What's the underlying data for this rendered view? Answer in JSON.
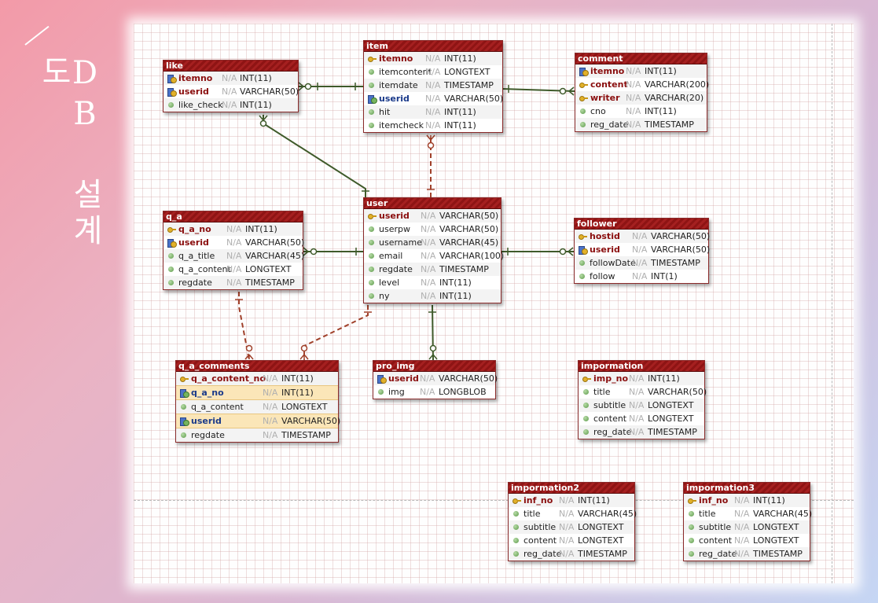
{
  "title": "DB 설계도",
  "colors": {
    "header": "#9a1a1a",
    "solid_link": "#3f5a2a",
    "dashed_link": "#a0402a"
  },
  "tables": [
    {
      "id": "like",
      "name": "like",
      "columns": [
        {
          "name": "itemno",
          "icon": "fk",
          "null": "N/A",
          "type": "INT(11)",
          "key": true
        },
        {
          "name": "userid",
          "icon": "fk",
          "null": "N/A",
          "type": "VARCHAR(50)",
          "key": true
        },
        {
          "name": "like_check",
          "icon": "dot",
          "null": "N/A",
          "type": "INT(11)"
        }
      ]
    },
    {
      "id": "item",
      "name": "item",
      "columns": [
        {
          "name": "itemno",
          "icon": "pk",
          "null": "N/A",
          "type": "INT(11)",
          "key": true
        },
        {
          "name": "itemcontent",
          "icon": "dot",
          "null": "N/A",
          "type": "LONGTEXT"
        },
        {
          "name": "itemdate",
          "icon": "dot",
          "null": "N/A",
          "type": "TIMESTAMP"
        },
        {
          "name": "userid",
          "icon": "fkn",
          "null": "N/A",
          "type": "VARCHAR(50)",
          "fk": true
        },
        {
          "name": "hit",
          "icon": "dot",
          "null": "N/A",
          "type": "INT(11)"
        },
        {
          "name": "itemcheck",
          "icon": "dot",
          "null": "N/A",
          "type": "INT(11)"
        }
      ]
    },
    {
      "id": "comment",
      "name": "comment",
      "columns": [
        {
          "name": "itemno",
          "icon": "fk",
          "null": "N/A",
          "type": "INT(11)",
          "key": true
        },
        {
          "name": "content",
          "icon": "pk",
          "null": "N/A",
          "type": "VARCHAR(200)",
          "key": true
        },
        {
          "name": "writer",
          "icon": "pk",
          "null": "N/A",
          "type": "VARCHAR(20)",
          "key": true
        },
        {
          "name": "cno",
          "icon": "dot",
          "null": "N/A",
          "type": "INT(11)"
        },
        {
          "name": "reg_date",
          "icon": "dot",
          "null": "N/A",
          "type": "TIMESTAMP"
        }
      ]
    },
    {
      "id": "q_a",
      "name": "q_a",
      "columns": [
        {
          "name": "q_a_no",
          "icon": "pk",
          "null": "N/A",
          "type": "INT(11)",
          "key": true
        },
        {
          "name": "userid",
          "icon": "fk",
          "null": "N/A",
          "type": "VARCHAR(50)",
          "key": true
        },
        {
          "name": "q_a_title",
          "icon": "dot",
          "null": "N/A",
          "type": "VARCHAR(45)"
        },
        {
          "name": "q_a_content",
          "icon": "dot",
          "null": "N/A",
          "type": "LONGTEXT"
        },
        {
          "name": "regdate",
          "icon": "dot",
          "null": "N/A",
          "type": "TIMESTAMP"
        }
      ]
    },
    {
      "id": "user",
      "name": "user",
      "columns": [
        {
          "name": "userid",
          "icon": "pk",
          "null": "N/A",
          "type": "VARCHAR(50)",
          "key": true
        },
        {
          "name": "userpw",
          "icon": "dot",
          "null": "N/A",
          "type": "VARCHAR(50)"
        },
        {
          "name": "username",
          "icon": "dot",
          "null": "N/A",
          "type": "VARCHAR(45)"
        },
        {
          "name": "email",
          "icon": "dot",
          "null": "N/A",
          "type": "VARCHAR(100)"
        },
        {
          "name": "regdate",
          "icon": "dot",
          "null": "N/A",
          "type": "TIMESTAMP"
        },
        {
          "name": "level",
          "icon": "dot",
          "null": "N/A",
          "type": "INT(11)"
        },
        {
          "name": "ny",
          "icon": "dot",
          "null": "N/A",
          "type": "INT(11)"
        }
      ]
    },
    {
      "id": "follower",
      "name": "follower",
      "columns": [
        {
          "name": "hostid",
          "icon": "pk",
          "null": "N/A",
          "type": "VARCHAR(50)",
          "key": true
        },
        {
          "name": "userid",
          "icon": "fk",
          "null": "N/A",
          "type": "VARCHAR(50)",
          "key": true
        },
        {
          "name": "followDate",
          "icon": "dot",
          "null": "N/A",
          "type": "TIMESTAMP"
        },
        {
          "name": "follow",
          "icon": "dot",
          "null": "N/A",
          "type": "INT(1)"
        }
      ]
    },
    {
      "id": "q_a_comments",
      "name": "q_a_comments",
      "columns": [
        {
          "name": "q_a_content_no",
          "icon": "pk",
          "null": "N/A",
          "type": "INT(11)",
          "key": true
        },
        {
          "name": "q_a_no",
          "icon": "fkn",
          "null": "N/A",
          "type": "INT(11)",
          "fk": true,
          "hl": true
        },
        {
          "name": "q_a_content",
          "icon": "dot",
          "null": "N/A",
          "type": "LONGTEXT"
        },
        {
          "name": "userid",
          "icon": "fkn",
          "null": "N/A",
          "type": "VARCHAR(50)",
          "fk": true,
          "hl": true
        },
        {
          "name": "regdate",
          "icon": "dot",
          "null": "N/A",
          "type": "TIMESTAMP"
        }
      ]
    },
    {
      "id": "pro_img",
      "name": "pro_img",
      "columns": [
        {
          "name": "userid",
          "icon": "fk",
          "null": "N/A",
          "type": "VARCHAR(50)",
          "key": true
        },
        {
          "name": "img",
          "icon": "dot",
          "null": "N/A",
          "type": "LONGBLOB"
        }
      ]
    },
    {
      "id": "impormation",
      "name": "impormation",
      "columns": [
        {
          "name": "imp_no",
          "icon": "pk",
          "null": "N/A",
          "type": "INT(11)",
          "key": true
        },
        {
          "name": "title",
          "icon": "dot",
          "null": "N/A",
          "type": "VARCHAR(50)"
        },
        {
          "name": "subtitle",
          "icon": "dot",
          "null": "N/A",
          "type": "LONGTEXT"
        },
        {
          "name": "content",
          "icon": "dot",
          "null": "N/A",
          "type": "LONGTEXT"
        },
        {
          "name": "reg_date",
          "icon": "dot",
          "null": "N/A",
          "type": "TIMESTAMP"
        }
      ]
    },
    {
      "id": "impormation2",
      "name": "impormation2",
      "columns": [
        {
          "name": "inf_no",
          "icon": "pk",
          "null": "N/A",
          "type": "INT(11)",
          "key": true
        },
        {
          "name": "title",
          "icon": "dot",
          "null": "N/A",
          "type": "VARCHAR(45)"
        },
        {
          "name": "subtitle",
          "icon": "dot",
          "null": "N/A",
          "type": "LONGTEXT"
        },
        {
          "name": "content",
          "icon": "dot",
          "null": "N/A",
          "type": "LONGTEXT"
        },
        {
          "name": "reg_date",
          "icon": "dot",
          "null": "N/A",
          "type": "TIMESTAMP"
        }
      ]
    },
    {
      "id": "impormation3",
      "name": "impormation3",
      "columns": [
        {
          "name": "inf_no",
          "icon": "pk",
          "null": "N/A",
          "type": "INT(11)",
          "key": true
        },
        {
          "name": "title",
          "icon": "dot",
          "null": "N/A",
          "type": "VARCHAR(45)"
        },
        {
          "name": "subtitle",
          "icon": "dot",
          "null": "N/A",
          "type": "LONGTEXT"
        },
        {
          "name": "content",
          "icon": "dot",
          "null": "N/A",
          "type": "LONGTEXT"
        },
        {
          "name": "reg_date",
          "icon": "dot",
          "null": "N/A",
          "type": "TIMESTAMP"
        }
      ]
    }
  ],
  "relations": [
    {
      "from": "item",
      "to": "like",
      "style": "solid"
    },
    {
      "from": "item",
      "to": "comment",
      "style": "solid"
    },
    {
      "from": "user",
      "to": "like",
      "style": "solid"
    },
    {
      "from": "user",
      "to": "item",
      "style": "dashed"
    },
    {
      "from": "user",
      "to": "q_a",
      "style": "solid"
    },
    {
      "from": "user",
      "to": "follower",
      "style": "solid"
    },
    {
      "from": "user",
      "to": "pro_img",
      "style": "solid"
    },
    {
      "from": "q_a",
      "to": "q_a_comments",
      "style": "dashed"
    },
    {
      "from": "user",
      "to": "q_a_comments",
      "style": "dashed"
    }
  ]
}
